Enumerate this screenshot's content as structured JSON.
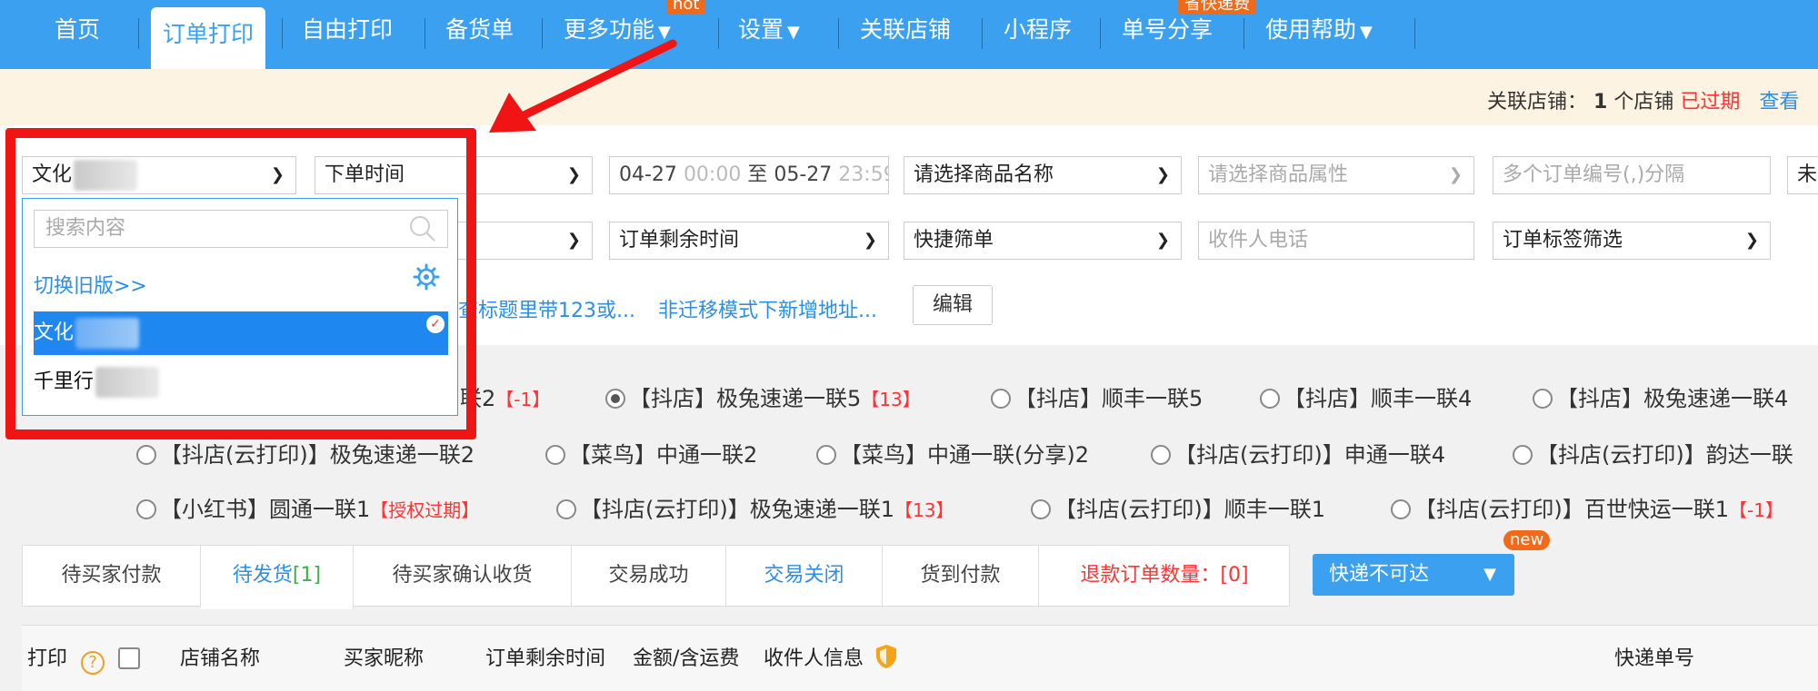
{
  "nav": {
    "items": [
      "首页",
      "订单打印",
      "自由打印",
      "备货单",
      "更多功能",
      "设置",
      "关联店铺",
      "小程序",
      "单号分享",
      "使用帮助"
    ],
    "hot_badge": "hot",
    "share_badge": "省快递费"
  },
  "notice": {
    "label": "关联店铺：",
    "count": "1",
    "unit": "个店铺",
    "status": "已过期",
    "view": "查看"
  },
  "filters": {
    "shop_select": "文化",
    "order_time": "下单时间",
    "date_start": "04-27",
    "time_start": "00:00",
    "to": "至",
    "date_end": "05-27",
    "time_end": "23:59",
    "product_name": "请选择商品名称",
    "product_attr": "请选择商品属性",
    "order_no_placeholder": "多个订单编号(,)分隔",
    "unprinted": "未",
    "remaining_time": "订单剩余时间",
    "quick_filter": "快捷筛单",
    "phone_placeholder": "收件人电话",
    "tag_filter": "订单标签筛选",
    "tip1": "查标题里带123或...",
    "tip2": "非迁移模式下新增地址...",
    "edit": "编辑"
  },
  "dropdown": {
    "search_placeholder": "搜索内容",
    "switch_old": "切换旧版>>",
    "options": [
      "文化",
      "千里行"
    ]
  },
  "templates": {
    "row1": [
      {
        "text": "联2",
        "badge": "【-1】"
      },
      {
        "text": "【抖店】极兔速递一联5",
        "badge": "【13】"
      },
      {
        "text": "【抖店】顺丰一联5",
        "badge": ""
      },
      {
        "text": "【抖店】顺丰一联4",
        "badge": ""
      },
      {
        "text": "【抖店】极兔速递一联4",
        "badge": ""
      }
    ],
    "row2": [
      {
        "text": "【抖店(云打印)】极兔速递一联2"
      },
      {
        "text": "【菜鸟】中通一联2"
      },
      {
        "text": "【菜鸟】中通一联(分享)2"
      },
      {
        "text": "【抖店(云打印)】申通一联4"
      },
      {
        "text": "【抖店(云打印)】韵达一联"
      }
    ],
    "row3": [
      {
        "text": "【小红书】圆通一联1",
        "badge": "【授权过期】"
      },
      {
        "text": "【抖店(云打印)】极兔速递一联1",
        "badge": "【13】"
      },
      {
        "text": "【抖店(云打印)】顺丰一联1",
        "badge": ""
      },
      {
        "text": "【抖店(云打印)】百世快运一联1",
        "badge": "【-1】"
      }
    ]
  },
  "tabs": {
    "items": [
      "待买家付款",
      "待发货",
      "待买家确认收货",
      "交易成功",
      "交易关闭",
      "货到付款"
    ],
    "pending_count": "[1]",
    "refund_label": "退款订单数量：",
    "refund_count": "[0]",
    "express": "快递不可达",
    "new_badge": "new"
  },
  "table": {
    "headers": [
      "打印",
      "店铺名称",
      "买家昵称",
      "订单剩余时间",
      "金额/含运费",
      "收件人信息",
      "快递单号"
    ]
  },
  "colors": {
    "primary": "#3aa0ef",
    "alert": "#f01414",
    "orange": "#f06a1b"
  }
}
